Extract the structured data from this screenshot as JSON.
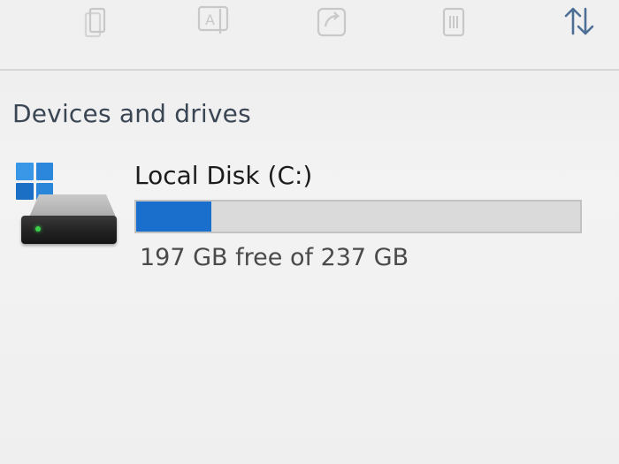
{
  "toolbar": {
    "buttons": [
      {
        "name": "copy",
        "icon": "copy-icon"
      },
      {
        "name": "rename",
        "icon": "rename-icon"
      },
      {
        "name": "share",
        "icon": "share-icon"
      },
      {
        "name": "delete",
        "icon": "trash-icon"
      },
      {
        "name": "sort",
        "icon": "sort-icon"
      }
    ]
  },
  "section": {
    "title": "Devices and drives"
  },
  "drive": {
    "name": "Local Disk (C:)",
    "free_text": "197 GB free of 237 GB",
    "used_fraction": 0.17,
    "icon": "hard-drive-icon",
    "os_badge": "windows-logo-icon"
  },
  "colors": {
    "accent": "#1a6fcc",
    "bar_track": "#dadada",
    "section_title": "#3b4654"
  }
}
